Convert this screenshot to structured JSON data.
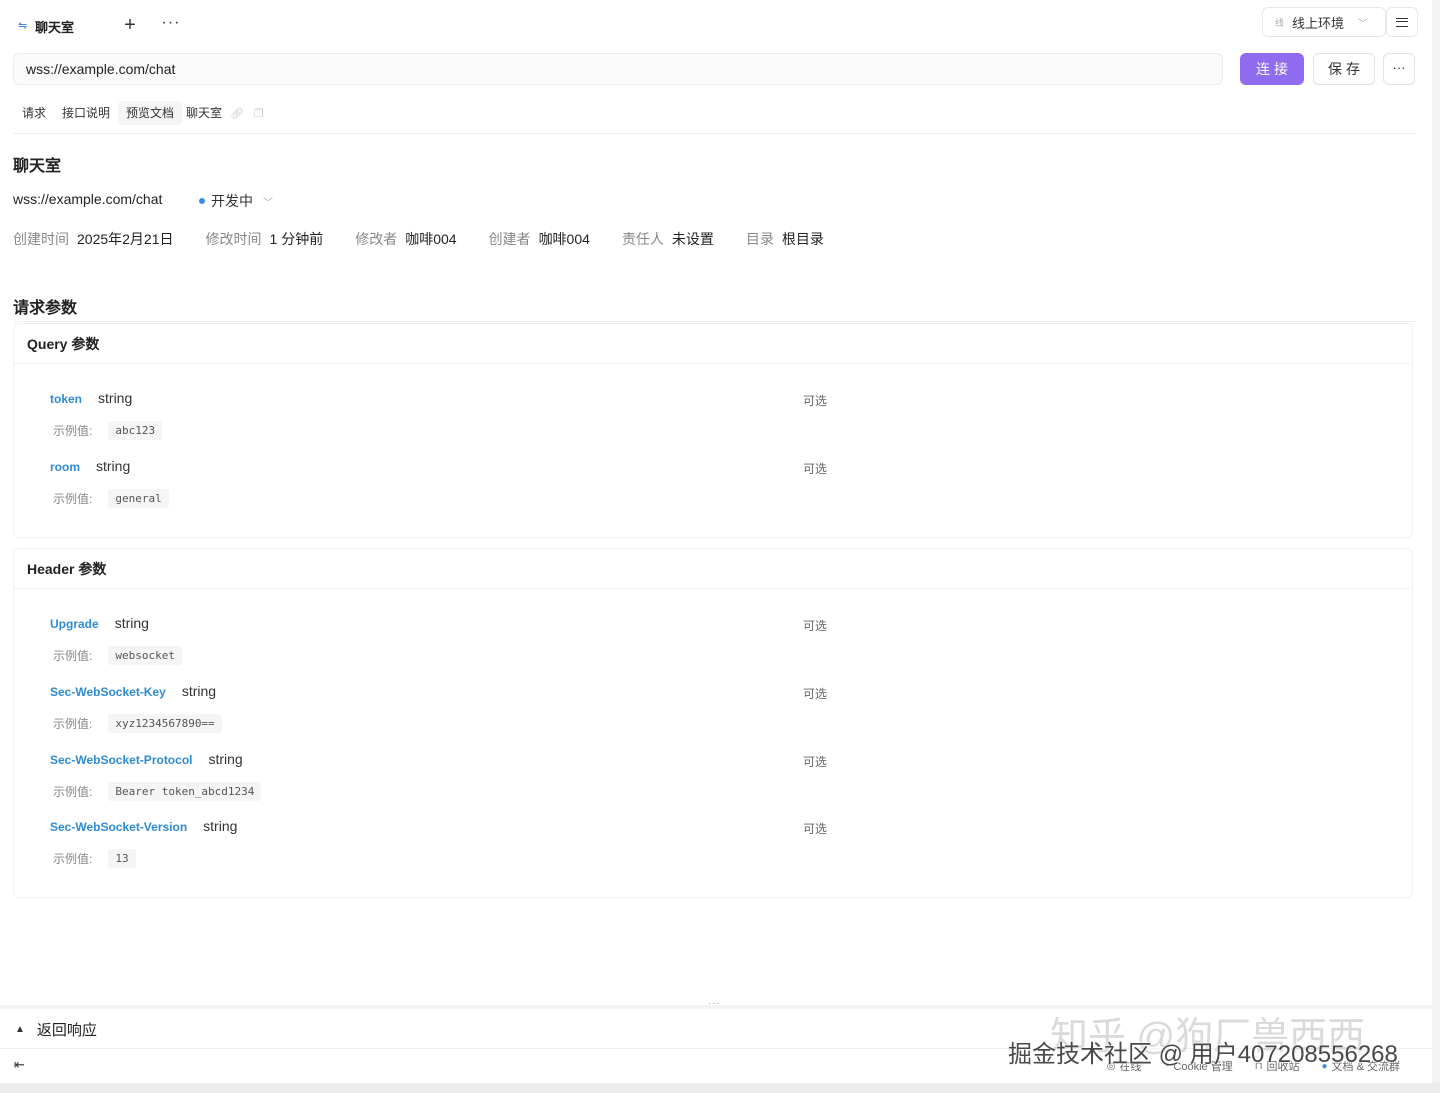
{
  "tabbar": {
    "tab_label": "聊天室",
    "add_symbol": "+",
    "more_symbol": "···",
    "env_tag": "线",
    "env_label": "线上环境"
  },
  "url_row": {
    "url": "wss://example.com/chat",
    "connect_label": "连接",
    "save_label": "保存",
    "more_symbol": "···"
  },
  "subtabs": [
    "请求",
    "接口说明",
    "预览文档",
    "聊天室"
  ],
  "doc": {
    "title": "聊天室",
    "url": "wss://example.com/chat",
    "status": "开发中",
    "meta": [
      {
        "k": "创建时间",
        "v": "2025年2月21日"
      },
      {
        "k": "修改时间",
        "v": "1 分钟前"
      },
      {
        "k": "修改者",
        "v": "咖啡004"
      },
      {
        "k": "创建者",
        "v": "咖啡004"
      },
      {
        "k": "责任人",
        "v": "未设置"
      },
      {
        "k": "目录",
        "v": "根目录"
      }
    ]
  },
  "request_params": {
    "title": "请求参数",
    "query": {
      "heading": "Query 参数",
      "params": [
        {
          "name": "token",
          "type": "string",
          "optional": "可选",
          "example_label": "示例值:",
          "example": "abc123"
        },
        {
          "name": "room",
          "type": "string",
          "optional": "可选",
          "example_label": "示例值:",
          "example": "general"
        }
      ]
    },
    "header": {
      "heading": "Header 参数",
      "params": [
        {
          "name": "Upgrade",
          "type": "string",
          "optional": "可选",
          "example_label": "示例值:",
          "example": "websocket"
        },
        {
          "name": "Sec-WebSocket-Key",
          "type": "string",
          "optional": "可选",
          "example_label": "示例值:",
          "example": "xyz1234567890=="
        },
        {
          "name": "Sec-WebSocket-Protocol",
          "type": "string",
          "optional": "可选",
          "example_label": "示例值:",
          "example": "Bearer token_abcd1234"
        },
        {
          "name": "Sec-WebSocket-Version",
          "type": "string",
          "optional": "可选",
          "example_label": "示例值:",
          "example": "13"
        }
      ]
    }
  },
  "bottom": {
    "handle": "···",
    "response_label": "返回响应",
    "status_items": [
      "在线",
      "Cookie 管理",
      "回收站",
      "文档 & 交流群"
    ]
  },
  "watermark": {
    "line1": "知乎 @狗厂兽西西",
    "line2": "掘金技术社区 @ 用户4072085562​68"
  },
  "colors": {
    "accent": "#8f6cf0",
    "param_name": "#2f8bd6",
    "status_dot": "#3a8ee6"
  }
}
